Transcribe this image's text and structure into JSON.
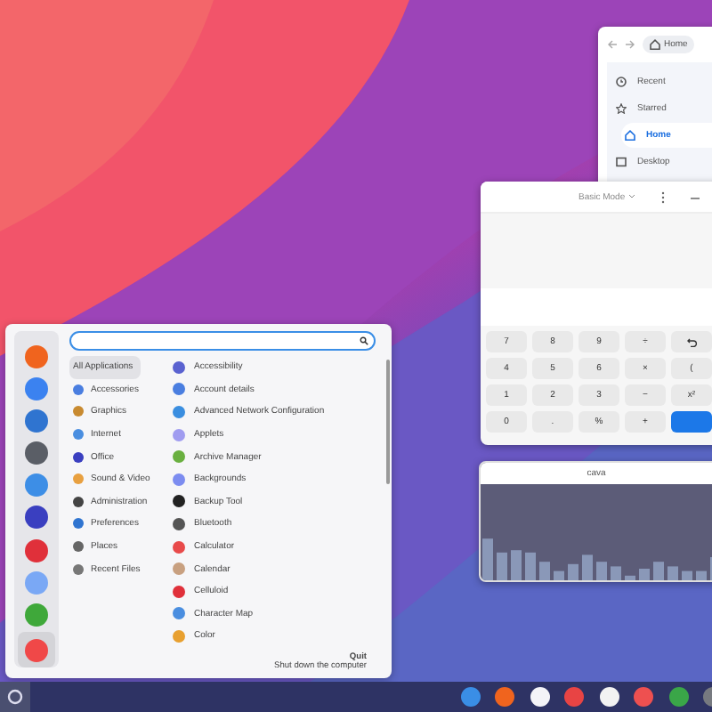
{
  "file_manager": {
    "path": "Home",
    "sidebar": [
      {
        "label": "Recent",
        "kind": "clock",
        "selected": false
      },
      {
        "label": "Starred",
        "kind": "star",
        "selected": false
      },
      {
        "label": "Home",
        "kind": "home",
        "selected": true
      },
      {
        "label": "Desktop",
        "kind": "desktop",
        "selected": false
      }
    ]
  },
  "calculator": {
    "mode": "Basic Mode",
    "keys": [
      {
        "label": "7",
        "kind": "key"
      },
      {
        "label": "8",
        "kind": "key"
      },
      {
        "label": "9",
        "kind": "key"
      },
      {
        "label": "÷",
        "kind": "key"
      },
      {
        "kind": "undo"
      },
      {
        "label": "4",
        "kind": "key"
      },
      {
        "label": "5",
        "kind": "key"
      },
      {
        "label": "6",
        "kind": "key"
      },
      {
        "label": "×",
        "kind": "key"
      },
      {
        "label": "(",
        "kind": "key"
      },
      {
        "label": "1",
        "kind": "key"
      },
      {
        "label": "2",
        "kind": "key"
      },
      {
        "label": "3",
        "kind": "key"
      },
      {
        "label": "−",
        "kind": "key"
      },
      {
        "label": "x²",
        "kind": "key"
      },
      {
        "label": "0",
        "kind": "key"
      },
      {
        "label": ".",
        "kind": "key"
      },
      {
        "label": "%",
        "kind": "key"
      },
      {
        "label": "+",
        "kind": "key"
      },
      {
        "kind": "equals"
      }
    ]
  },
  "visualizer": {
    "title": "cava"
  },
  "menu": {
    "favorites": [
      {
        "color": "#f0641e",
        "selected": false
      },
      {
        "color": "#3b82f0",
        "selected": false
      },
      {
        "color": "#2f74d0",
        "selected": false
      },
      {
        "color": "#5a5e66",
        "selected": false
      },
      {
        "color": "#3d8ee6",
        "selected": false
      },
      {
        "color": "#3a3fc0",
        "selected": false
      },
      {
        "color": "#e0303a",
        "selected": false
      },
      {
        "color": "#7aa8f5",
        "selected": false
      },
      {
        "color": "#3fa83a",
        "selected": false
      },
      {
        "color": "#f04848",
        "selected": true
      }
    ],
    "categories": [
      {
        "label": "All Applications",
        "selected": true
      },
      {
        "label": "Accessories",
        "color": "#4a7ee0",
        "selected": false
      },
      {
        "label": "Graphics",
        "color": "#c88a30",
        "selected": false
      },
      {
        "label": "Internet",
        "color": "#4a8ee0",
        "selected": false
      },
      {
        "label": "Office",
        "color": "#3a3fc0",
        "selected": false
      },
      {
        "label": "Sound & Video",
        "color": "#e8a040",
        "selected": false
      },
      {
        "label": "Administration",
        "color": "#444444",
        "selected": false
      },
      {
        "label": "Preferences",
        "color": "#2f74d0",
        "selected": false
      },
      {
        "label": "Places",
        "color": "#666666",
        "selected": false
      },
      {
        "label": "Recent Files",
        "color": "#777777",
        "selected": false
      }
    ],
    "apps": [
      {
        "label": "Accessibility",
        "color": "#5a62d0"
      },
      {
        "label": "Account details",
        "color": "#4a7ee0"
      },
      {
        "label": "Advanced Network Configuration",
        "color": "#3a8ee0"
      },
      {
        "label": "Applets",
        "color": "#a09cf0"
      },
      {
        "label": "Archive Manager",
        "color": "#6ab040"
      },
      {
        "label": "Backgrounds",
        "color": "#7c8cf0"
      },
      {
        "label": "Backup Tool",
        "color": "#222222"
      },
      {
        "label": "Bluetooth",
        "color": "#555555"
      },
      {
        "label": "Calculator",
        "color": "#e84a4a"
      },
      {
        "label": "Calendar",
        "color": "#c8a080"
      },
      {
        "label": "Celluloid",
        "color": "#e0303a"
      },
      {
        "label": "Character Map",
        "color": "#4a8ee0"
      },
      {
        "label": "Color",
        "color": "#e8a030"
      }
    ],
    "footer": {
      "title": "Quit",
      "description": "Shut down the computer"
    }
  },
  "taskbar": {
    "dock": [
      {
        "color": "#3a8ee6"
      },
      {
        "color": "#f0641e"
      },
      {
        "color": "#f4f4f8"
      },
      {
        "color": "#e84444"
      },
      {
        "color": "#f2f2f2"
      },
      {
        "color": "#ee5050"
      },
      {
        "color": "#3aa648"
      },
      {
        "color": "#777a80"
      }
    ]
  }
}
